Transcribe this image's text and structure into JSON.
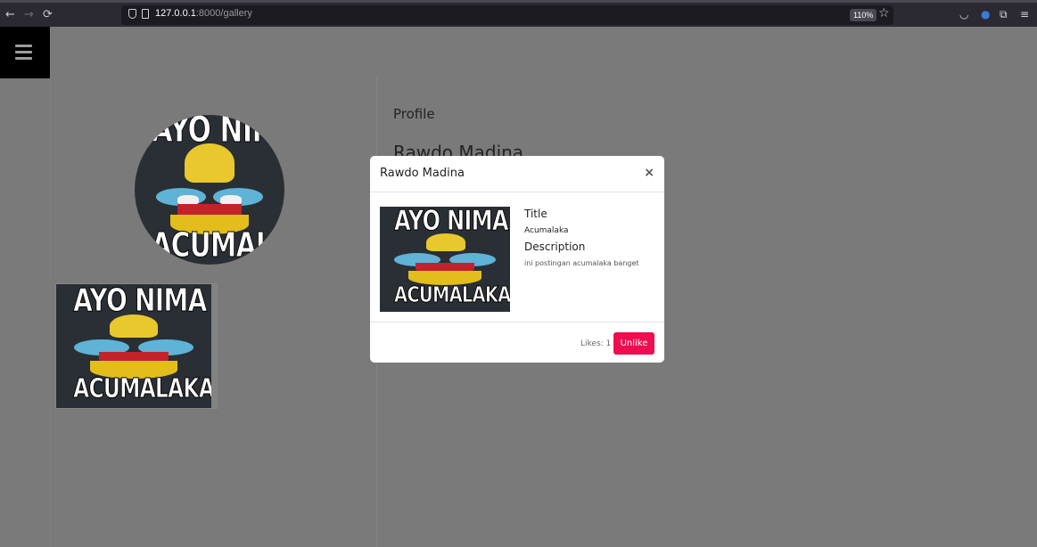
{
  "browser": {
    "url_host": "127.0.0.1",
    "url_rest": ":8000/gallery",
    "zoom": "110%"
  },
  "profile": {
    "label": "Profile",
    "name": "Rawdo Madina"
  },
  "meme": {
    "top_text": "AYO NIMA",
    "bottom_text": "ACUMALAKA"
  },
  "modal": {
    "title": "Rawdo Madina",
    "close": "×",
    "title_heading": "Title",
    "title_value": "Acumalaka",
    "description_heading": "Description",
    "description_value": "ini postingan acumalaka banget",
    "likes": "Likes: 1",
    "unlike_label": "Unlike"
  },
  "colors": {
    "unlike_button": "#ef0d50",
    "overlay": "#7a7a7a"
  }
}
